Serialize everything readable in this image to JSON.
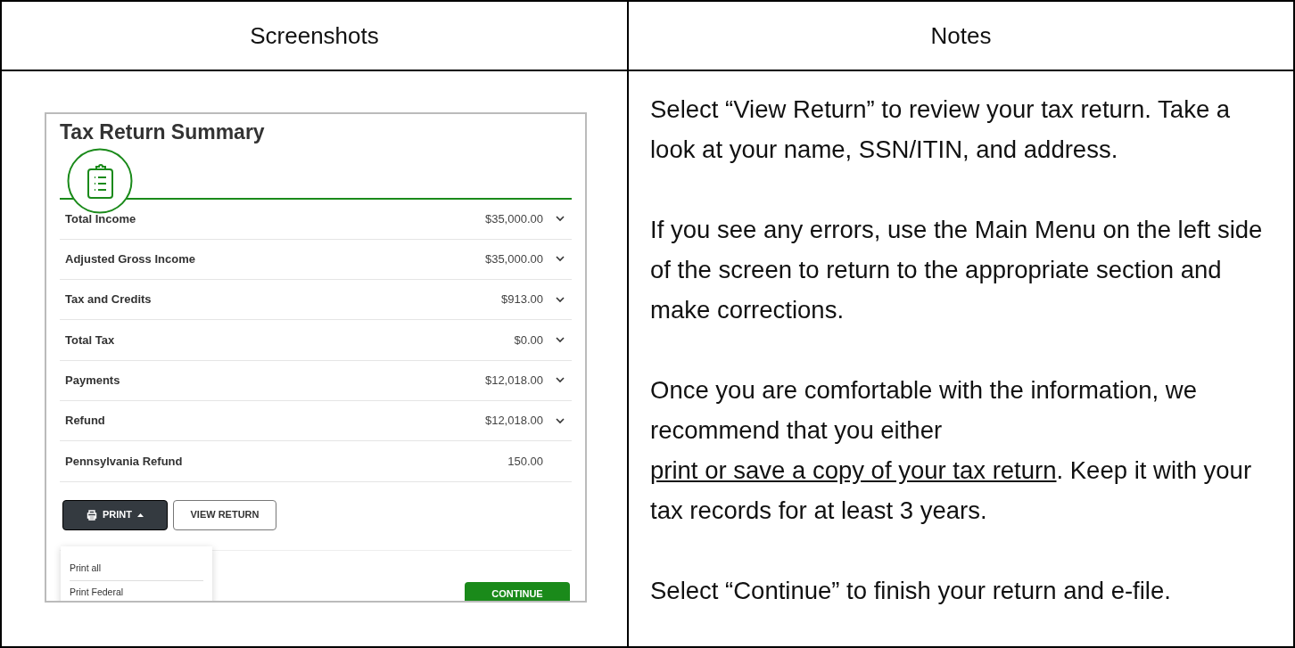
{
  "table": {
    "columns": [
      "Screenshots",
      "Notes"
    ],
    "screenshot": {
      "title": "Tax Return Summary",
      "rows": [
        {
          "label": "Total Income",
          "value": "$35,000.00",
          "kind": "expandable",
          "expanded": false
        },
        {
          "label": "Adjusted Gross Income",
          "value": "$35,000.00",
          "kind": "expandable",
          "expanded": false
        },
        {
          "label": "Tax and Credits",
          "value": "$913.00",
          "kind": "expandable",
          "expanded": false
        },
        {
          "label": "Total Tax",
          "value": "$0.00",
          "kind": "expandable",
          "expanded": false
        },
        {
          "label": "Payments",
          "value": "$12,018.00",
          "kind": "expandable",
          "expanded": false
        },
        {
          "label": "Refund",
          "value": "$12,018.00",
          "kind": "expandable",
          "expanded": false
        },
        {
          "label": "Pennsylvania Refund",
          "value": "150.00",
          "kind": "plain"
        }
      ],
      "print_button": {
        "label": "PRINT",
        "expanded": true
      },
      "view_button": "VIEW RETURN",
      "print_menu": [
        "Print all",
        "Print Federal"
      ],
      "continue_button": "CONTINUE"
    },
    "notes": [
      {
        "text": "Select “View Return” to review your tax return. Take a look at your name, SSN/ITIN, and address."
      },
      {
        "text": "If you see any errors, use the Main Menu on the left side of the screen to return to the appropriate section and make corrections."
      },
      {
        "before": "Once you are comfortable with the information, we recommend that you either ",
        "link": "print or save a copy of your tax return",
        "after": ".  Keep it with your tax records for at least 3 years."
      },
      {
        "text": "Select “Continue” to finish your return and e-file."
      }
    ]
  }
}
